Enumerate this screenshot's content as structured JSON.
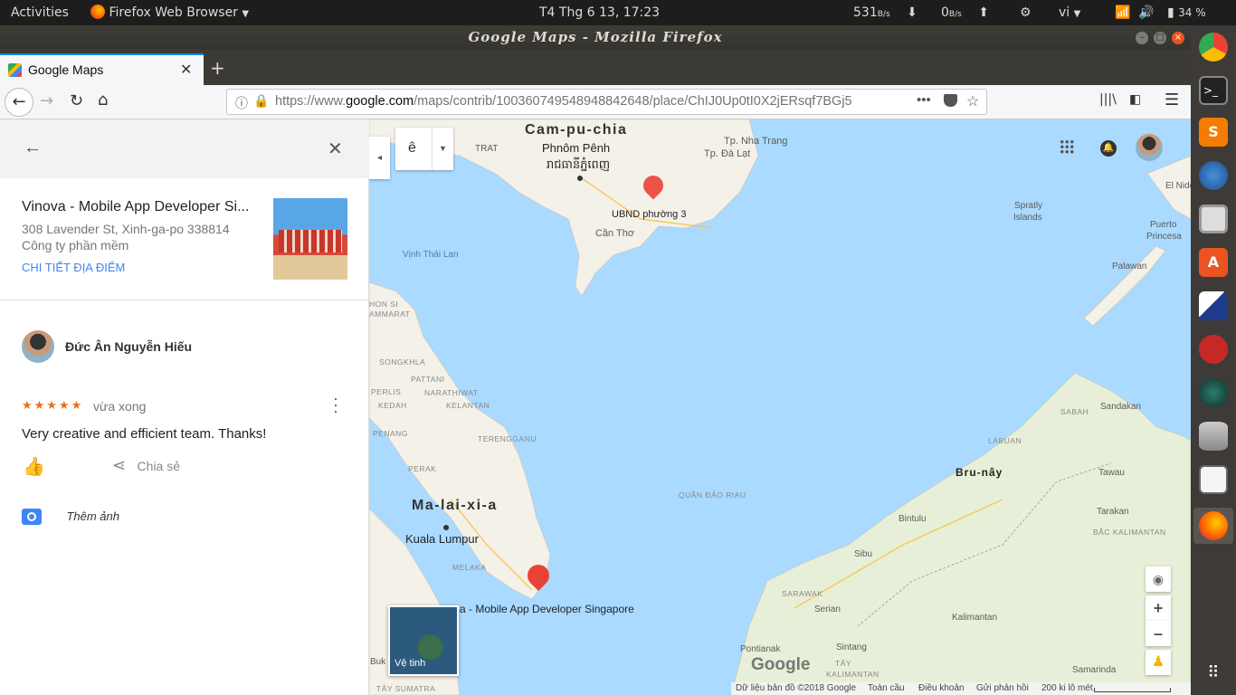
{
  "topbar": {
    "activities": "Activities",
    "app_name": "Firefox Web Browser",
    "clock": "T4 Thg 6 13, 17:23",
    "net_down_value": "531",
    "net_down_unit": "B/s",
    "net_up_value": "0",
    "net_up_unit": "B/s",
    "lang": "vi",
    "battery": "34 %"
  },
  "window": {
    "title": "Google Maps - Mozilla Firefox"
  },
  "tab": {
    "title": "Google Maps"
  },
  "urlbar": {
    "url_prefix": "https://www.",
    "url_domain": "google.com",
    "url_path": "/maps/contrib/100360749548948842648/place/ChIJ0Up0tI0X2jERsqf7BGj5"
  },
  "panel": {
    "place_name": "Vinova - Mobile App Developer Si...",
    "place_address": "308 Lavender St, Xinh-ga-po 338814",
    "place_category": "Công ty phần mềm",
    "place_details_link": "CHI TIẾT ĐỊA ĐIỂM",
    "reviewer_name": "Đức Ân Nguyễn Hiếu",
    "rating_stars": "★★★★★",
    "rating_value": 5,
    "review_time": "vừa xong",
    "review_text": "Very creative and efficient team. Thanks!",
    "share_label": "Chia sẻ",
    "add_photo_label": "Thêm ảnh"
  },
  "map": {
    "search_char": "ê",
    "satellite_label": "Vệ tinh",
    "pin_label_1": "UBND phường 3",
    "pin_label_2": "a - Mobile App Developer Singapore",
    "labels": {
      "cambodia": "Cam-pu-chia",
      "phnompenh": "Phnôm Pênh",
      "phnompenh_khmer": "រាជធានីភ្នំពេញ",
      "nhatrang": "Tp. Nha Trang",
      "dalat": "Tp. Đà Lạt",
      "cantho": "Cần Thơ",
      "thaigulf": "Vịnh Thái Lan",
      "spratly1": "Spratly",
      "spratly2": "Islands",
      "elnido": "El Nido",
      "puerto1": "Puerto",
      "puerto2": "Princesa",
      "palawan": "Palawan",
      "chonsi": "HON SI",
      "ammarat": "AMMARAT",
      "songkhla": "SONGKHLA",
      "pattani": "PATTANI",
      "perlis": "PERLIS",
      "narathiwat": "NARATHIWAT",
      "kedah": "KEDAH",
      "kelantan": "KELANTAN",
      "penang": "PENANG",
      "terengganu": "TERENGGANU",
      "perak": "PERAK",
      "malaysia": "Ma-lai-xi-a",
      "kl": "Kuala Lumpur",
      "melaka": "MELAKA",
      "quandaoriau": "QUẦN ĐẢO RIAU",
      "sabah": "SABAH",
      "sandakan": "Sandakan",
      "labuan": "LABUAN",
      "brunei": "Bru-nây",
      "tawau": "Tawau",
      "bintulu": "Bintulu",
      "bakalimantan": "BẮC KALIMANTAN",
      "tarakan": "Tarakan",
      "sibu": "Sibu",
      "sarawak": "SARAWAK",
      "serian": "Serian",
      "kalimantan": "Kalimantan",
      "pontianak": "Pontianak",
      "sintang": "Sintang",
      "tay": "TÂY",
      "kalimantan_caps": "KALIMANTAN",
      "samarinda": "Samarinda",
      "buk": "Buk",
      "taysumatra": "TÂY SUMATRA",
      "trat": "TRAT"
    },
    "footer": {
      "data": "Dữ liệu bản đồ ©2018 Google",
      "world": "Toàn cầu",
      "terms": "Điều khoản",
      "feedback": "Gửi phản hồi",
      "scale": "200 ki lô mét"
    },
    "google_logo": "Google"
  },
  "colors": {
    "water": "#aadaff",
    "land": "#f4f1e9",
    "pin": "#ea4335",
    "accent_blue": "#1a73e8",
    "star": "#e7711b"
  }
}
